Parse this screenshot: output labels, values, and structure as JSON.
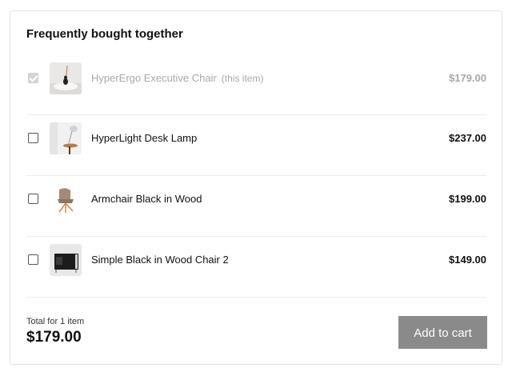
{
  "title": "Frequently bought together",
  "items": [
    {
      "name": "HyperErgo Executive Chair",
      "note": "(this item)",
      "price": "$179.00",
      "checked": true,
      "icon": "office-chair-image"
    },
    {
      "name": "HyperLight Desk Lamp",
      "price": "$237.00",
      "checked": false,
      "icon": "desk-lamp-image"
    },
    {
      "name": "Armchair Black in Wood",
      "price": "$199.00",
      "checked": false,
      "icon": "armchair-image"
    },
    {
      "name": "Simple Black in Wood Chair 2",
      "price": "$149.00",
      "checked": false,
      "icon": "black-chair-image"
    }
  ],
  "footer": {
    "total_label": "Total for 1 item",
    "total_value": "$179.00",
    "add_to_cart_label": "Add to cart"
  },
  "colors": {
    "button_bg": "#8a8a8a",
    "muted_text": "#a8a8a8",
    "divider": "#ececec"
  }
}
